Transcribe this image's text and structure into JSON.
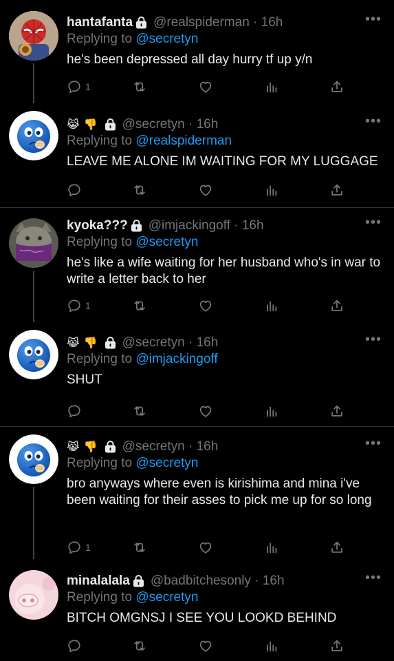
{
  "colors": {
    "background": "#000000",
    "text": "#e7e9ea",
    "muted": "#71767b",
    "link": "#1d9bf0",
    "separator": "#2f3336"
  },
  "tweets": [
    {
      "name": "hantafanta",
      "handle": "@realspiderman · 16h",
      "replying_prefix": "Replying to ",
      "replying_to": "@secretyn",
      "text": "he's been depressed all day hurry tf up y/n",
      "reply_count": "1",
      "avatar": "spiderman-avatar"
    },
    {
      "name": "",
      "emojis": [
        "😹",
        "👎"
      ],
      "handle": "@secretyn · 16h",
      "replying_prefix": "Replying to ",
      "replying_to": "@realspiderman",
      "text": "LEAVE ME ALONE IM WAITING FOR MY LUGGAGE",
      "reply_count": "",
      "avatar": "blue-emoji-avatar"
    },
    {
      "name": "kyoka???",
      "handle": "@imjackingoff · 16h",
      "replying_prefix": "Replying to ",
      "replying_to": "@secretyn",
      "text": "he's like a wife waiting for her husband who's in war to write a letter back to her",
      "reply_count": "1",
      "avatar": "cat-bandana-avatar"
    },
    {
      "name": "",
      "emojis": [
        "😹",
        "👎"
      ],
      "handle": "@secretyn · 16h",
      "replying_prefix": "Replying to ",
      "replying_to": "@imjackingoff",
      "text": "SHUT",
      "reply_count": "",
      "avatar": "blue-emoji-avatar"
    },
    {
      "name": "",
      "emojis": [
        "😹",
        "👎"
      ],
      "handle": "@secretyn · 16h",
      "replying_prefix": "Replying to ",
      "replying_to": "@secretyn",
      "text": "bro anyways where even is kirishima and mina i've been waiting for their asses to pick me up for so long",
      "reply_count": "1",
      "avatar": "blue-emoji-avatar"
    },
    {
      "name": "minalalala",
      "handle": "@badbitchesonly · 16h",
      "replying_prefix": "Replying to ",
      "replying_to": "@secretyn",
      "text": "BITCH OMGNSJ I SEE YOU LOOKD BEHIND",
      "reply_count": "",
      "avatar": "pink-avatar"
    }
  ],
  "icons": [
    "reply-icon",
    "retweet-icon",
    "like-icon",
    "analytics-icon",
    "share-icon",
    "lock-icon",
    "more-icon"
  ]
}
